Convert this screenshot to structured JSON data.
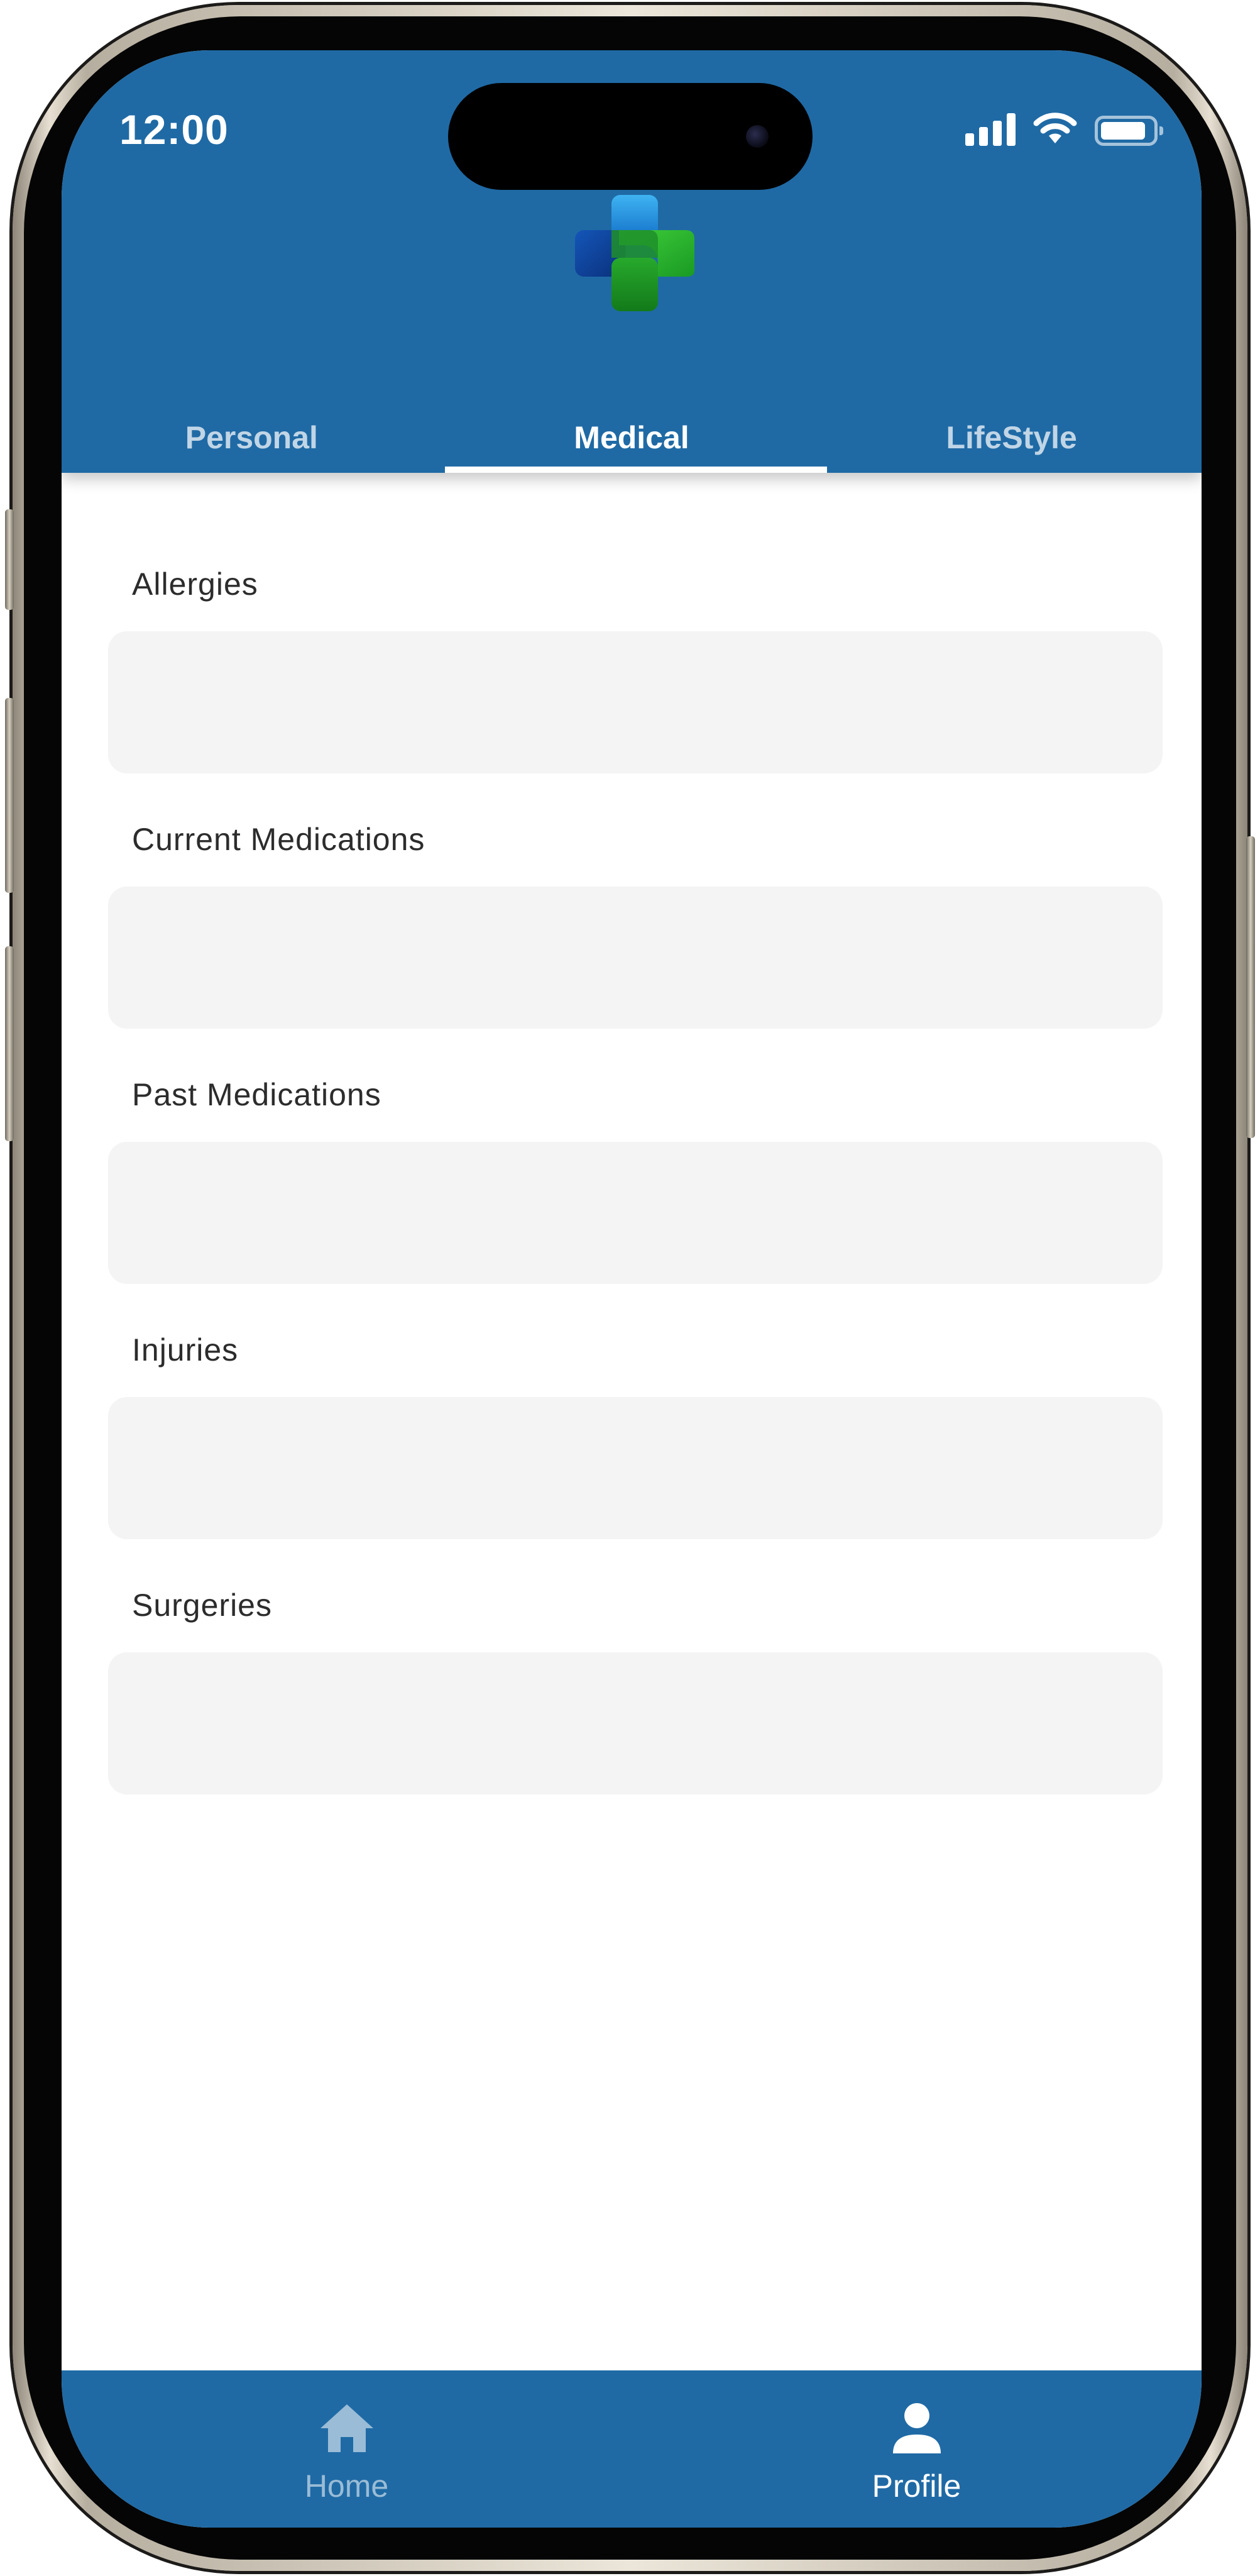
{
  "status_bar": {
    "time": "12:00",
    "icons": [
      "cellular-signal-icon",
      "wifi-icon",
      "battery-icon"
    ]
  },
  "header": {
    "logo": "medical-cross-logo",
    "background_color": "#1f6aa5"
  },
  "tabs": [
    {
      "label": "Personal",
      "active": false
    },
    {
      "label": "Medical",
      "active": true
    },
    {
      "label": "LifeStyle",
      "active": false
    }
  ],
  "form": {
    "fields": [
      {
        "label": "Allergies",
        "value": ""
      },
      {
        "label": "Current Medications",
        "value": ""
      },
      {
        "label": "Past Medications",
        "value": ""
      },
      {
        "label": "Injuries",
        "value": ""
      },
      {
        "label": "Surgeries",
        "value": ""
      }
    ]
  },
  "bottom_nav": {
    "items": [
      {
        "label": "Home",
        "icon": "home-icon",
        "active": false
      },
      {
        "label": "Profile",
        "icon": "person-icon",
        "active": true
      }
    ]
  }
}
